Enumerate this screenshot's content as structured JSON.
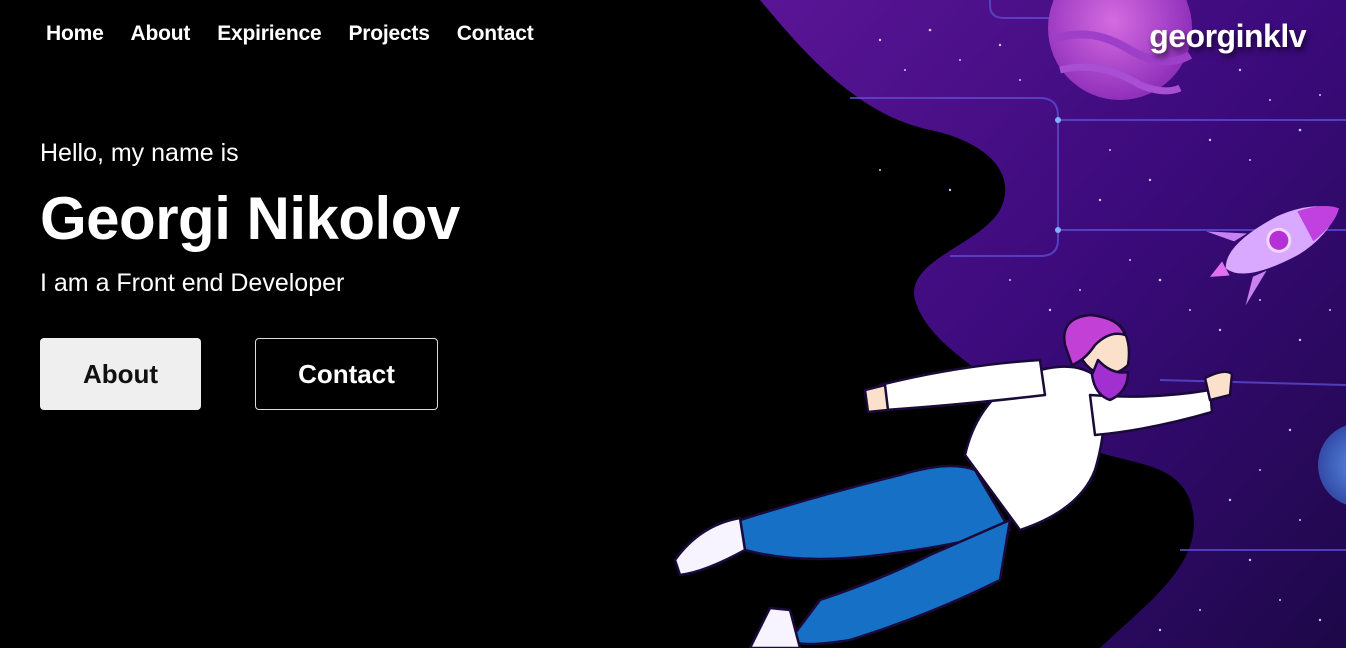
{
  "nav": {
    "items": [
      {
        "label": "Home"
      },
      {
        "label": "About"
      },
      {
        "label": "Expirience"
      },
      {
        "label": "Projects"
      },
      {
        "label": "Contact"
      }
    ]
  },
  "brand": {
    "label": "georginklv"
  },
  "hero": {
    "greeting": "Hello, my name is",
    "name": "Georgi Nikolov",
    "role": "I am a Front end Developer",
    "about_button": "About",
    "contact_button": "Contact"
  },
  "colors": {
    "background": "#000000",
    "space_purple": "#3a0a7a",
    "accent_magenta": "#b12bd6",
    "pants_blue": "#1671c6"
  }
}
